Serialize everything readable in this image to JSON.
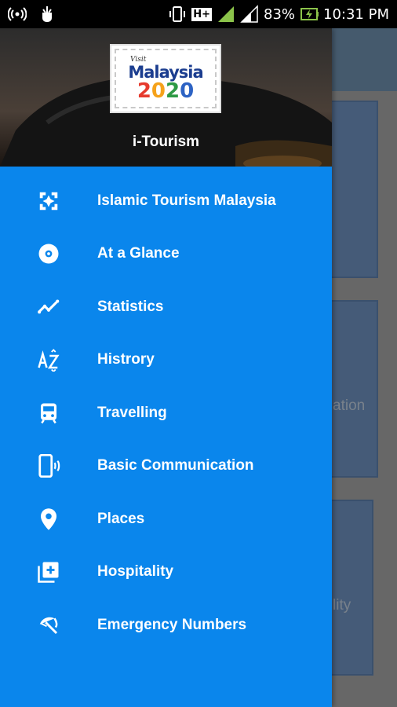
{
  "status_bar": {
    "battery_percent": "83%",
    "time": "10:31 PM",
    "network_type": "H+",
    "sim1_label": "1",
    "sim2_label": "2"
  },
  "drawer": {
    "header_title": "i-Tourism",
    "logo": {
      "visit": "Visit",
      "country": "Malaysia",
      "year": [
        "2",
        "0",
        "2",
        "0"
      ]
    },
    "items": [
      {
        "label": "Islamic Tourism Malaysia",
        "icon": "islamic-pattern-icon"
      },
      {
        "label": "At a Glance",
        "icon": "disc-icon"
      },
      {
        "label": "Statistics",
        "icon": "trending-icon"
      },
      {
        "label": "Histrory",
        "icon": "sort-az-icon"
      },
      {
        "label": "Travelling",
        "icon": "train-icon"
      },
      {
        "label": "Basic Communication",
        "icon": "phone-vibrate-icon"
      },
      {
        "label": "Places",
        "icon": "location-pin-icon"
      },
      {
        "label": "Hospitality",
        "icon": "add-box-icon"
      },
      {
        "label": "Emergency Numbers",
        "icon": "beach-umbrella-icon"
      }
    ]
  },
  "background": {
    "card_text_1": "ation",
    "card_text_2": "lity"
  },
  "colors": {
    "drawer_bg": "#0a86ec",
    "status_bar_bg": "#000000",
    "signal_green": "#8bc34a"
  }
}
